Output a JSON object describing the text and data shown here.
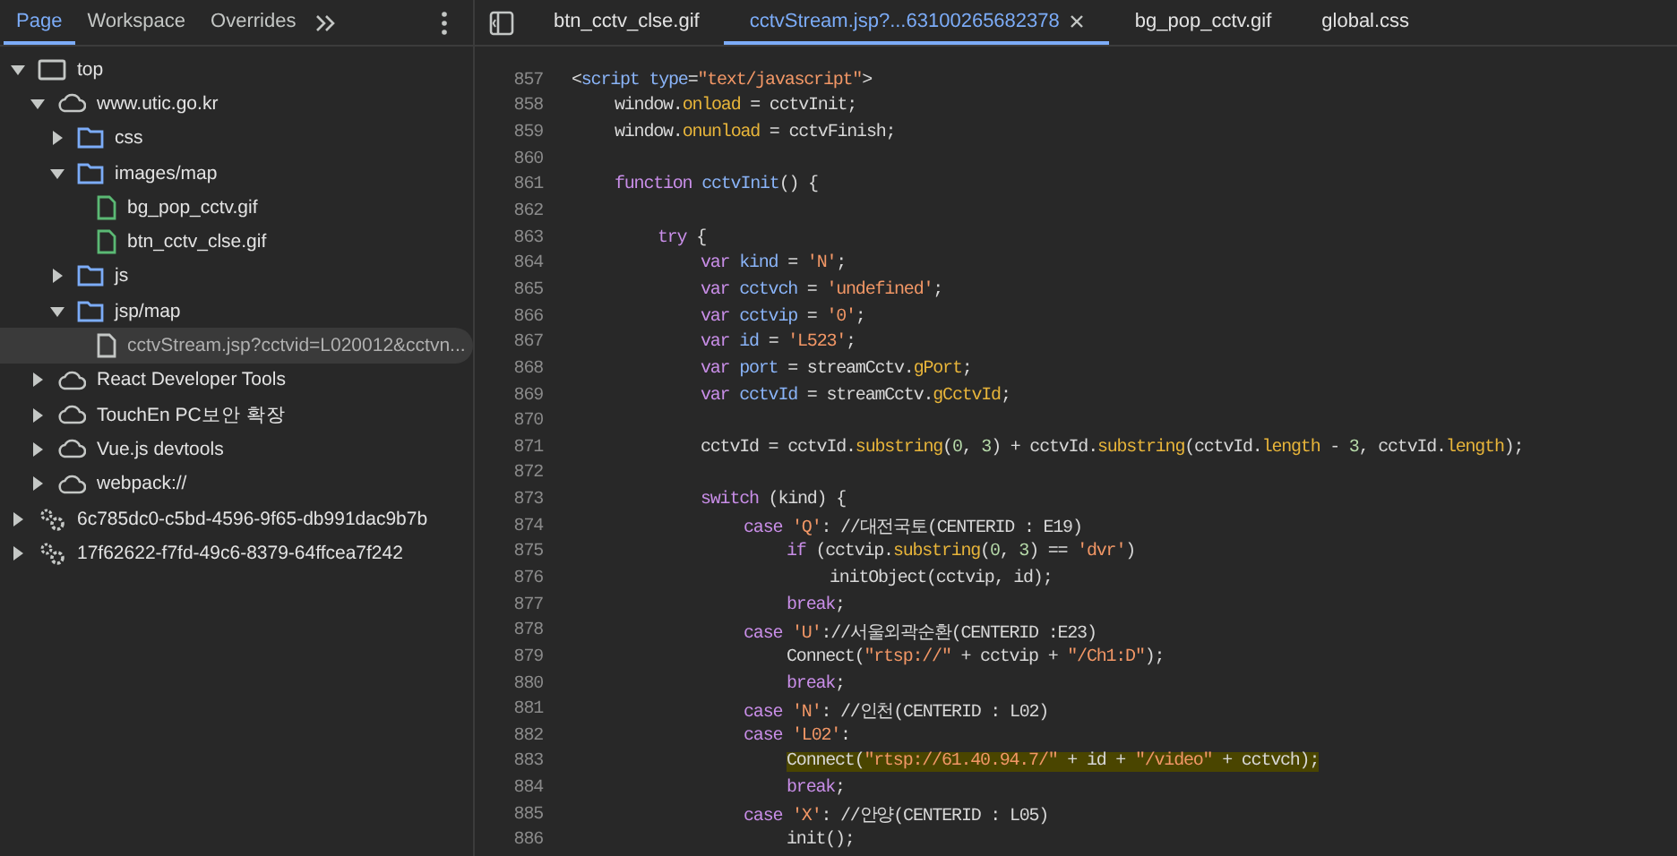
{
  "navigator": {
    "tabs": [
      {
        "label": "Page",
        "selected": true
      },
      {
        "label": "Workspace",
        "selected": false
      },
      {
        "label": "Overrides",
        "selected": false
      }
    ],
    "tree": [
      {
        "label": "top",
        "kind": "frame",
        "expanded": true,
        "selected": false,
        "children": [
          {
            "label": "www.utic.go.kr",
            "kind": "domain",
            "expanded": true,
            "selected": false,
            "children": [
              {
                "label": "css",
                "kind": "folder",
                "expanded": false,
                "selected": false
              },
              {
                "label": "images/map",
                "kind": "folder",
                "expanded": true,
                "selected": false,
                "children": [
                  {
                    "label": "bg_pop_cctv.gif",
                    "kind": "image",
                    "selected": false
                  },
                  {
                    "label": "btn_cctv_clse.gif",
                    "kind": "image",
                    "selected": false
                  }
                ]
              },
              {
                "label": "js",
                "kind": "folder",
                "expanded": false,
                "selected": false
              },
              {
                "label": "jsp/map",
                "kind": "folder",
                "expanded": true,
                "selected": false,
                "children": [
                  {
                    "label": "cctvStream.jsp?cctvid=L020012&cctvn...",
                    "kind": "document",
                    "selected": true
                  }
                ]
              }
            ]
          },
          {
            "label": "React Developer Tools",
            "kind": "domain",
            "expanded": false,
            "selected": false
          },
          {
            "label": "TouchEn PC보안 확장",
            "kind": "domain",
            "expanded": false,
            "selected": false
          },
          {
            "label": "Vue.js devtools",
            "kind": "domain",
            "expanded": false,
            "selected": false
          },
          {
            "label": "webpack://",
            "kind": "domain",
            "expanded": false,
            "selected": false
          }
        ]
      },
      {
        "label": "6c785dc0-c5bd-4596-9f65-db991dac9b7b",
        "kind": "worker",
        "expanded": false,
        "selected": false
      },
      {
        "label": "17f62622-f7fd-49c6-8379-64ffcea7f242",
        "kind": "worker",
        "expanded": false,
        "selected": false
      }
    ]
  },
  "editor": {
    "tabs": [
      {
        "label": "btn_cctv_clse.gif",
        "selected": false,
        "closable": false
      },
      {
        "label": "cctvStream.jsp?...63100265682378",
        "selected": true,
        "closable": true
      },
      {
        "label": "bg_pop_cctv.gif",
        "selected": false,
        "closable": false
      },
      {
        "label": "global.css",
        "selected": false,
        "closable": false
      }
    ],
    "lines": [
      {
        "number": "857",
        "highlighted": false,
        "tokens": [
          {
            "kind": "p",
            "text": "<"
          },
          {
            "kind": "tag",
            "text": "script "
          },
          {
            "kind": "tag",
            "text": "type"
          },
          {
            "kind": "p",
            "text": "="
          },
          {
            "kind": "str",
            "text": "\"text/javascript\""
          },
          {
            "kind": "p",
            "text": ">"
          }
        ],
        "children": [
          {
            "number": "858",
            "highlighted": false,
            "tokens": [
              {
                "kind": "p",
                "text": "window."
              },
              {
                "kind": "prop",
                "text": "onload"
              },
              {
                "kind": "p",
                "text": " = cctvInit;"
              }
            ]
          },
          {
            "number": "859",
            "highlighted": false,
            "tokens": [
              {
                "kind": "p",
                "text": "window."
              },
              {
                "kind": "prop",
                "text": "onunload"
              },
              {
                "kind": "p",
                "text": " = cctvFinish;"
              }
            ]
          },
          {
            "number": "860"
          },
          {
            "number": "861",
            "highlighted": false,
            "tokens": [
              {
                "kind": "kw",
                "text": "function "
              },
              {
                "kind": "id",
                "text": "cctvInit"
              },
              {
                "kind": "p",
                "text": "() {"
              }
            ],
            "children": [
              {
                "number": "862"
              },
              {
                "number": "863",
                "highlighted": false,
                "tokens": [
                  {
                    "kind": "kw",
                    "text": "try"
                  },
                  {
                    "kind": "p",
                    "text": " {"
                  }
                ],
                "children": [
                  {
                    "number": "864",
                    "highlighted": false,
                    "tokens": [
                      {
                        "kind": "kw",
                        "text": "var "
                      },
                      {
                        "kind": "id",
                        "text": "kind"
                      },
                      {
                        "kind": "p",
                        "text": " = "
                      },
                      {
                        "kind": "str",
                        "text": "'N'"
                      },
                      {
                        "kind": "p",
                        "text": ";"
                      }
                    ]
                  },
                  {
                    "number": "865",
                    "highlighted": false,
                    "tokens": [
                      {
                        "kind": "kw",
                        "text": "var "
                      },
                      {
                        "kind": "id",
                        "text": "cctvch"
                      },
                      {
                        "kind": "p",
                        "text": " = "
                      },
                      {
                        "kind": "str",
                        "text": "'undefined'"
                      },
                      {
                        "kind": "p",
                        "text": ";"
                      }
                    ]
                  },
                  {
                    "number": "866",
                    "highlighted": false,
                    "tokens": [
                      {
                        "kind": "kw",
                        "text": "var "
                      },
                      {
                        "kind": "id",
                        "text": "cctvip"
                      },
                      {
                        "kind": "p",
                        "text": " = "
                      },
                      {
                        "kind": "str",
                        "text": "'0'"
                      },
                      {
                        "kind": "p",
                        "text": ";"
                      }
                    ]
                  },
                  {
                    "number": "867",
                    "highlighted": false,
                    "tokens": [
                      {
                        "kind": "kw",
                        "text": "var "
                      },
                      {
                        "kind": "id",
                        "text": "id"
                      },
                      {
                        "kind": "p",
                        "text": " = "
                      },
                      {
                        "kind": "str",
                        "text": "'L523'"
                      },
                      {
                        "kind": "p",
                        "text": ";"
                      }
                    ]
                  },
                  {
                    "number": "868",
                    "highlighted": false,
                    "tokens": [
                      {
                        "kind": "kw",
                        "text": "var "
                      },
                      {
                        "kind": "id",
                        "text": "port"
                      },
                      {
                        "kind": "p",
                        "text": " = streamCctv."
                      },
                      {
                        "kind": "prop",
                        "text": "gPort"
                      },
                      {
                        "kind": "p",
                        "text": ";"
                      }
                    ]
                  },
                  {
                    "number": "869",
                    "highlighted": false,
                    "tokens": [
                      {
                        "kind": "kw",
                        "text": "var "
                      },
                      {
                        "kind": "id",
                        "text": "cctvId"
                      },
                      {
                        "kind": "p",
                        "text": " = streamCctv."
                      },
                      {
                        "kind": "prop",
                        "text": "gCctvId"
                      },
                      {
                        "kind": "p",
                        "text": ";"
                      }
                    ]
                  },
                  {
                    "number": "870"
                  },
                  {
                    "number": "871",
                    "highlighted": false,
                    "tokens": [
                      {
                        "kind": "p",
                        "text": "cctvId = cctvId."
                      },
                      {
                        "kind": "prop",
                        "text": "substring"
                      },
                      {
                        "kind": "p",
                        "text": "("
                      },
                      {
                        "kind": "num",
                        "text": "0"
                      },
                      {
                        "kind": "p",
                        "text": ", "
                      },
                      {
                        "kind": "num",
                        "text": "3"
                      },
                      {
                        "kind": "p",
                        "text": ") + cctvId."
                      },
                      {
                        "kind": "prop",
                        "text": "substring"
                      },
                      {
                        "kind": "p",
                        "text": "(cctvId."
                      },
                      {
                        "kind": "prop",
                        "text": "length"
                      },
                      {
                        "kind": "p",
                        "text": " - "
                      },
                      {
                        "kind": "num",
                        "text": "3"
                      },
                      {
                        "kind": "p",
                        "text": ", cctvId."
                      },
                      {
                        "kind": "prop",
                        "text": "length"
                      },
                      {
                        "kind": "p",
                        "text": ");"
                      }
                    ]
                  },
                  {
                    "number": "872"
                  },
                  {
                    "number": "873",
                    "highlighted": false,
                    "tokens": [
                      {
                        "kind": "kw",
                        "text": "switch"
                      },
                      {
                        "kind": "p",
                        "text": " (kind) {"
                      }
                    ],
                    "children": [
                      {
                        "number": "874",
                        "highlighted": false,
                        "tokens": [
                          {
                            "kind": "kw",
                            "text": "case "
                          },
                          {
                            "kind": "str",
                            "text": "'Q'"
                          },
                          {
                            "kind": "p",
                            "text": ": //대전국토(CENTERID : E19)"
                          }
                        ],
                        "children": [
                          {
                            "number": "875",
                            "highlighted": false,
                            "tokens": [
                              {
                                "kind": "kw",
                                "text": "if"
                              },
                              {
                                "kind": "p",
                                "text": " (cctvip."
                              },
                              {
                                "kind": "prop",
                                "text": "substring"
                              },
                              {
                                "kind": "p",
                                "text": "("
                              },
                              {
                                "kind": "num",
                                "text": "0"
                              },
                              {
                                "kind": "p",
                                "text": ", "
                              },
                              {
                                "kind": "num",
                                "text": "3"
                              },
                              {
                                "kind": "p",
                                "text": ") == "
                              },
                              {
                                "kind": "str",
                                "text": "'dvr'"
                              },
                              {
                                "kind": "p",
                                "text": ")"
                              }
                            ],
                            "children": [
                              {
                                "number": "876",
                                "highlighted": false,
                                "tokens": [
                                  {
                                    "kind": "p",
                                    "text": "initObject(cctvip, id);"
                                  }
                                ]
                              }
                            ]
                          },
                          {
                            "number": "877",
                            "highlighted": false,
                            "tokens": [
                              {
                                "kind": "kw",
                                "text": "break"
                              },
                              {
                                "kind": "p",
                                "text": ";"
                              }
                            ]
                          }
                        ]
                      },
                      {
                        "number": "878",
                        "highlighted": false,
                        "tokens": [
                          {
                            "kind": "kw",
                            "text": "case "
                          },
                          {
                            "kind": "str",
                            "text": "'U'"
                          },
                          {
                            "kind": "p",
                            "text": "://서울외곽순환(CENTERID :E23)"
                          }
                        ],
                        "children": [
                          {
                            "number": "879",
                            "highlighted": false,
                            "tokens": [
                              {
                                "kind": "p",
                                "text": "Connect("
                              },
                              {
                                "kind": "str",
                                "text": "\"rtsp://\""
                              },
                              {
                                "kind": "p",
                                "text": " + cctvip + "
                              },
                              {
                                "kind": "str",
                                "text": "\"/Ch1:D\""
                              },
                              {
                                "kind": "p",
                                "text": ");"
                              }
                            ]
                          },
                          {
                            "number": "880",
                            "highlighted": false,
                            "tokens": [
                              {
                                "kind": "kw",
                                "text": "break"
                              },
                              {
                                "kind": "p",
                                "text": ";"
                              }
                            ]
                          }
                        ]
                      },
                      {
                        "number": "881",
                        "highlighted": false,
                        "tokens": [
                          {
                            "kind": "kw",
                            "text": "case "
                          },
                          {
                            "kind": "str",
                            "text": "'N'"
                          },
                          {
                            "kind": "p",
                            "text": ": //인천(CENTERID : L02)"
                          }
                        ]
                      },
                      {
                        "number": "882",
                        "highlighted": false,
                        "tokens": [
                          {
                            "kind": "kw",
                            "text": "case "
                          },
                          {
                            "kind": "str",
                            "text": "'L02'"
                          },
                          {
                            "kind": "p",
                            "text": ":"
                          }
                        ],
                        "children": [
                          {
                            "number": "883",
                            "highlighted": true,
                            "tokens": [
                              {
                                "kind": "p",
                                "text": "Connect("
                              },
                              {
                                "kind": "str",
                                "text": "\"rtsp://61.40.94.7/\""
                              },
                              {
                                "kind": "p",
                                "text": " + id + "
                              },
                              {
                                "kind": "str",
                                "text": "\"/video\""
                              },
                              {
                                "kind": "p",
                                "text": " + cctvch);"
                              }
                            ]
                          },
                          {
                            "number": "884",
                            "highlighted": false,
                            "tokens": [
                              {
                                "kind": "kw",
                                "text": "break"
                              },
                              {
                                "kind": "p",
                                "text": ";"
                              }
                            ]
                          }
                        ]
                      },
                      {
                        "number": "885",
                        "highlighted": false,
                        "tokens": [
                          {
                            "kind": "kw",
                            "text": "case "
                          },
                          {
                            "kind": "str",
                            "text": "'X'"
                          },
                          {
                            "kind": "p",
                            "text": ": //안양(CENTERID : L05)"
                          }
                        ],
                        "children": [
                          {
                            "number": "886",
                            "highlighted": false,
                            "tokens": [
                              {
                                "kind": "p",
                                "text": "init();"
                              }
                            ]
                          }
                        ]
                      }
                    ]
                  }
                ]
              }
            ]
          }
        ]
      }
    ]
  }
}
